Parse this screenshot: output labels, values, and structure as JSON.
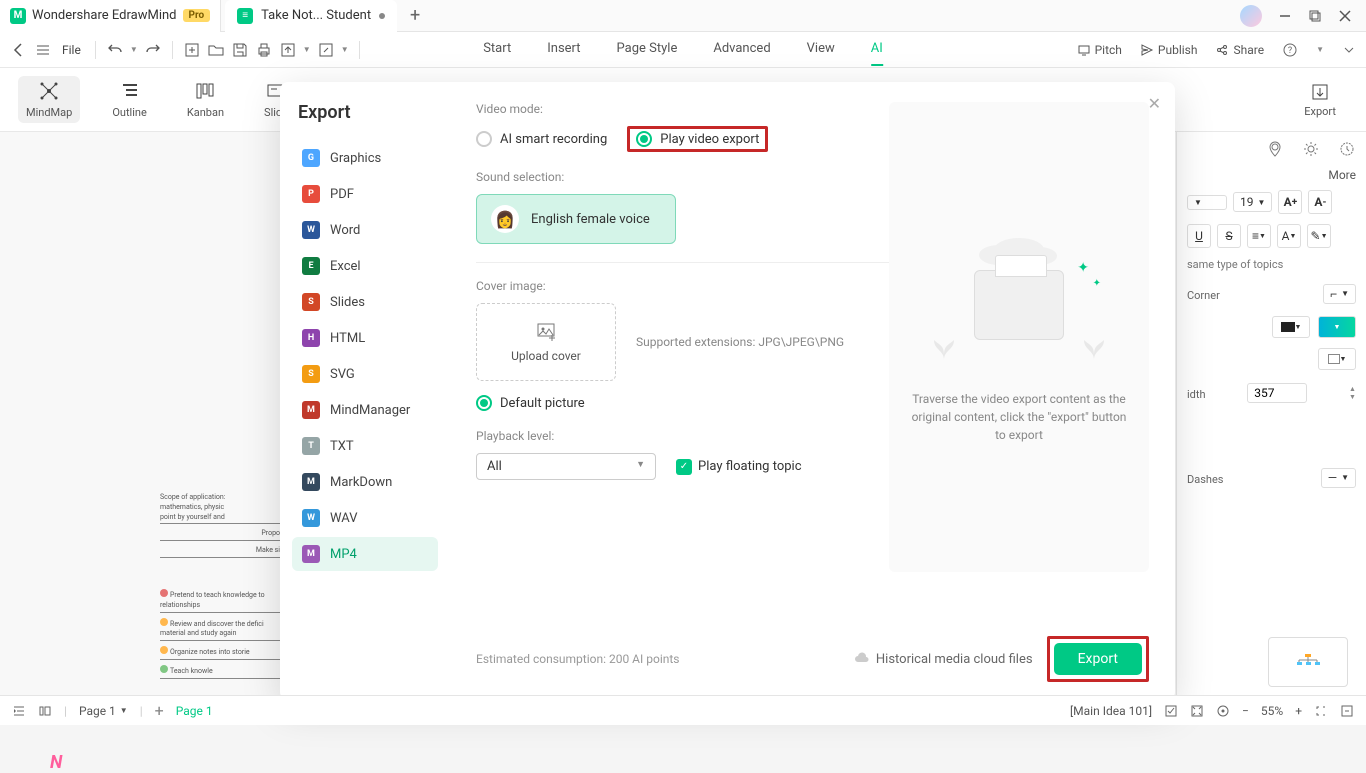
{
  "titlebar": {
    "app_name": "Wondershare EdrawMind",
    "pro": "Pro",
    "doc_tab": "Take Not... Student"
  },
  "menu": {
    "items": [
      "Start",
      "Insert",
      "Page Style",
      "Advanced",
      "View",
      "AI"
    ],
    "active": "AI",
    "file": "File"
  },
  "toolbar_right": {
    "pitch": "Pitch",
    "publish": "Publish",
    "share": "Share"
  },
  "ribbon": {
    "mindmap": "MindMap",
    "outline": "Outline",
    "kanban": "Kanban",
    "slide": "Slide",
    "export": "Export"
  },
  "modal": {
    "title": "Export",
    "formats": [
      "Graphics",
      "PDF",
      "Word",
      "Excel",
      "Slides",
      "HTML",
      "SVG",
      "MindManager",
      "TXT",
      "MarkDown",
      "WAV",
      "MP4"
    ],
    "fmt_colors": [
      "#4da6ff",
      "#e74c3c",
      "#2b579a",
      "#107c41",
      "#d24726",
      "#8e44ad",
      "#f39c12",
      "#c0392b",
      "#95a5a6",
      "#34495e",
      "#3498db",
      "#9b59b6"
    ],
    "selected": "MP4",
    "video_mode_lbl": "Video mode:",
    "opt1": "AI smart recording",
    "opt2": "Play video export",
    "sound_lbl": "Sound selection:",
    "voice": "English female voice",
    "cover_lbl": "Cover image:",
    "upload": "Upload cover",
    "support": "Supported extensions: JPG\\JPEG\\PNG",
    "default_pic": "Default picture",
    "playback_lbl": "Playback level:",
    "playback_val": "All",
    "float_chk": "Play floating topic",
    "preview_txt": "Traverse the video export content as the original content, click the \"export\" button to export",
    "estimate": "Estimated consumption: 200 AI points",
    "cloud": "Historical media cloud files",
    "export_btn": "Export"
  },
  "right_panel": {
    "more": "More",
    "font_size": "19",
    "hint": "same type of topics",
    "corner": "Corner",
    "width_lbl": "idth",
    "width_val": "357",
    "dashes": "Dashes"
  },
  "statusbar": {
    "page_sel": "Page 1",
    "page_g": "Page 1",
    "main_idea": "[Main Idea 101]",
    "zoom": "55%"
  },
  "canvas": {
    "l1": "Scope of application:",
    "l2": "mathematics, physic",
    "l3": "point by yourself and",
    "l4": "Propo",
    "l5": "Make si",
    "l6": "Pretend to teach knowledge to",
    "l7": "relationships",
    "l8": "Review and discover the defici",
    "l9": "material and study again",
    "l10": "Organize notes into storie",
    "l11": "Teach knowle"
  }
}
